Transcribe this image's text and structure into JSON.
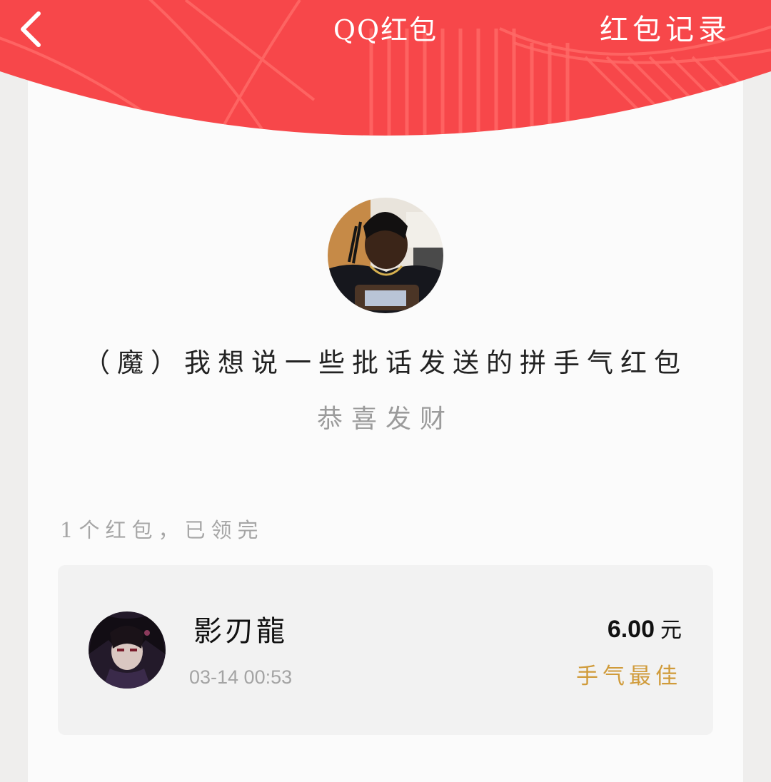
{
  "header": {
    "title": "QQ红包",
    "records_link": "红包记录",
    "back_icon": "chevron-left-icon",
    "bg_color": "#f7474a"
  },
  "sender": {
    "avatar": "sender-avatar",
    "message": "（魔）我想说一些批话发送的拼手气红包",
    "blessing": "恭喜发财"
  },
  "summary": "1个红包，已领完",
  "records": [
    {
      "avatar": "anime-avatar",
      "name": "影刃龍",
      "time": "03-14 00:53",
      "amount": "6.00",
      "unit": "元",
      "badge": "手气最佳"
    }
  ],
  "colors": {
    "accent_gold": "#d09b3a",
    "header_red": "#f7474a"
  }
}
